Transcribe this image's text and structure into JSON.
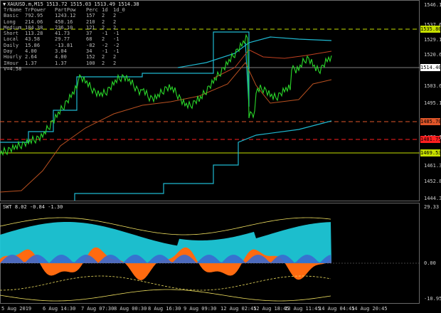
{
  "chart": {
    "symbol_line": "XAUUSD.m,M15  1513.72 1515.03 1513.49 1514.38"
  },
  "info_table": {
    "headers": [
      "TrName",
      "TrPower",
      "PartPow",
      "Perc",
      "1d",
      "1d_0"
    ],
    "rows": [
      [
        "Basic",
        "792.95",
        "1243.12",
        "157",
        "2",
        "2"
      ],
      [
        "Long",
        "214.06",
        "450.16",
        "210",
        "2",
        "2"
      ],
      [
        "Medium",
        "184.38",
        "236.10",
        "121",
        "2",
        "2"
      ],
      [
        "Short",
        "113.28",
        "41.73",
        "37",
        "-1",
        "-1"
      ],
      [
        "Local",
        "43.58",
        "29.77",
        "68",
        "2",
        "-1"
      ],
      [
        "Daily",
        "15.86",
        "-13.81",
        "-82",
        "-2",
        "-2"
      ],
      [
        "Day",
        "4.00",
        "3.04",
        "34",
        "-1",
        "-1"
      ],
      [
        "Hourly",
        "2.64",
        "4.00",
        "152",
        "2",
        "2"
      ],
      [
        "IHour",
        "1.37",
        "1.37",
        "100",
        "2",
        "2"
      ]
    ],
    "footer": "V=4.58"
  },
  "main_axis": {
    "labels": [
      "1546.10",
      "1537.60",
      "1529.10",
      "1520.60",
      "1503.60",
      "1495.10",
      "1478.10",
      "1461.35",
      "1452.85",
      "1444.35"
    ],
    "tags": [
      {
        "text": "1535.80",
        "color": "#c6e000"
      },
      {
        "text": "1514.40",
        "color": "#ffffff"
      },
      {
        "text": "1485.70",
        "color": "#e0562a"
      },
      {
        "text": "1481.75",
        "color": "#ff2020"
      },
      {
        "text": "1469.53",
        "color": "#c6e000"
      }
    ]
  },
  "sub_chart": {
    "title": "SWT 8.02 -0.84 -1.30",
    "axis_labels": [
      "29.33",
      "0.00",
      "-10.95"
    ]
  },
  "time_axis": [
    "5 Aug 2019",
    "6 Aug 14:30",
    "7 Aug 07:30",
    "8 Aug 00:30",
    "8 Aug 16:30",
    "9 Aug 09:30",
    "12 Aug 02:45",
    "12 Aug 18:45",
    "13 Aug 11:45",
    "14 Aug 04:45",
    "14 Aug 20:45"
  ]
}
